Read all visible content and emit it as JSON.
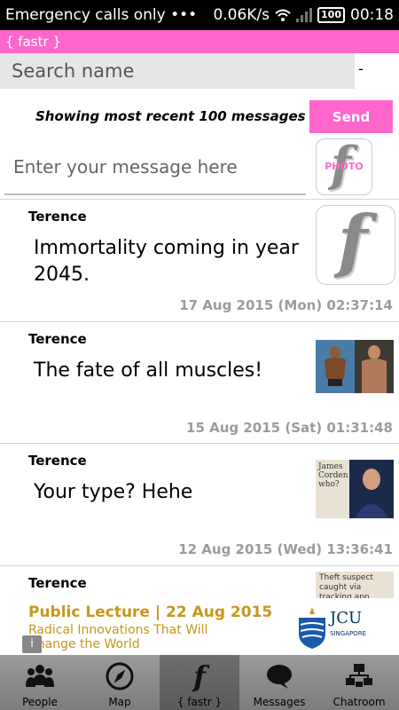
{
  "status_bar": {
    "carrier_text": "Emergency calls only",
    "dots": "•••",
    "speed": "0.06K/s",
    "battery": "100",
    "time": "00:18"
  },
  "app_bar": {
    "title": "{ fastr }"
  },
  "search": {
    "placeholder": "Search name",
    "dash": "-"
  },
  "composer": {
    "showing_text": "Showing most recent 100 messages",
    "send_label": "Send",
    "message_placeholder": "Enter your message here",
    "photo_label": "PHOTO"
  },
  "messages": [
    {
      "sender": "Terence",
      "text": "Immortality coming in year 2045.",
      "timestamp": "17 Aug 2015 (Mon) 02:37:14",
      "thumb": "fastr-logo-icon"
    },
    {
      "sender": "Terence",
      "text": "The fate of all muscles!",
      "timestamp": "15 Aug 2015 (Sat) 01:31:48",
      "thumb": "muscle-photo"
    },
    {
      "sender": "Terence",
      "text": "Your type? Hehe",
      "timestamp": "12 Aug 2015 (Wed) 13:36:41",
      "thumb": "news-photo",
      "thumb_text": "James Corden who?"
    },
    {
      "sender": "Terence",
      "thumb": "news-photo",
      "thumb_text": "Theft suspect caught via tracking app"
    }
  ],
  "ad": {
    "title": "Public Lecture | 22 Aug 2015",
    "subtitle": "Radical Innovations That Will Change the World",
    "logo_text": "JCU",
    "logo_sub": "SINGAPORE"
  },
  "nav": [
    {
      "label": "People",
      "icon": "people-icon"
    },
    {
      "label": "Map",
      "icon": "compass-icon"
    },
    {
      "label": "{ fastr }",
      "icon": "fastr-icon"
    },
    {
      "label": "Messages",
      "icon": "speech-bubble-icon"
    },
    {
      "label": "Chatroom",
      "icon": "chatroom-icon"
    }
  ],
  "colors": {
    "accent": "#ff66cc",
    "nav_bg": "#8c8c8c",
    "timestamp": "#9b9b9b",
    "ad_gold": "#c8961b",
    "jcu_blue": "#003366"
  }
}
